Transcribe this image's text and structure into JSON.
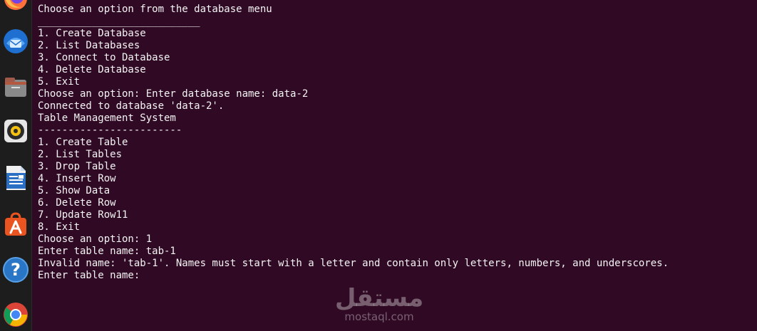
{
  "dock": {
    "items": [
      {
        "name": "firefox-icon"
      },
      {
        "name": "thunderbird-icon"
      },
      {
        "name": "files-icon"
      },
      {
        "name": "rhythmbox-icon"
      },
      {
        "name": "libreoffice-writer-icon"
      },
      {
        "name": "ubuntu-software-icon"
      },
      {
        "name": "help-icon"
      },
      {
        "name": "chrome-icon"
      }
    ],
    "accent": "#e95420"
  },
  "terminal": {
    "background": "#300a24",
    "foreground": "#f4f4f4",
    "lines": [
      "Choose an option from the database menu",
      "___________________________",
      "1. Create Database",
      "2. List Databases",
      "3. Connect to Database",
      "4. Delete Database",
      "5. Exit",
      "Choose an option: Enter database name: data-2",
      "Connected to database 'data-2'.",
      "Table Management System",
      "------------------------",
      "1. Create Table",
      "2. List Tables",
      "3. Drop Table",
      "4. Insert Row",
      "5. Show Data",
      "6. Delete Row",
      "7. Update Row11",
      "8. Exit",
      "Choose an option: 1",
      "Enter table name: tab-1",
      "Invalid name: 'tab-1'. Names must start with a letter and contain only letters, numbers, and underscores.",
      "Enter table name: "
    ]
  },
  "watermark": {
    "arabic": "مستقل",
    "latin": "mostaql.com"
  }
}
